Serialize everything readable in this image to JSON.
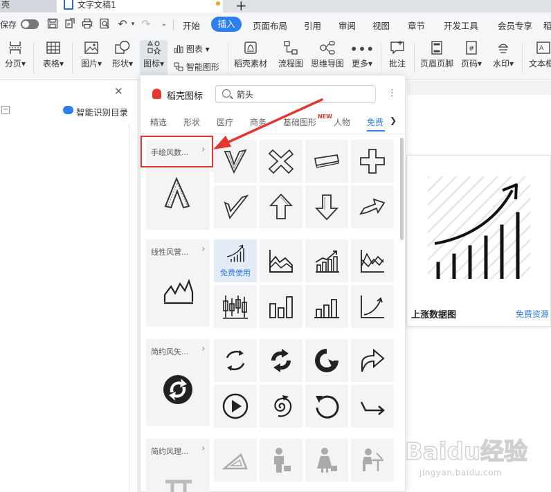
{
  "tabs": {
    "prev": "壳",
    "doc": "文字文稿1"
  },
  "menu": {
    "autosave": "保存",
    "items": [
      "开始",
      "插入",
      "页面布局",
      "引用",
      "审阅",
      "视图",
      "章节",
      "开发工具",
      "会员专享",
      "稻"
    ]
  },
  "toolbar": {
    "page_break": "分页",
    "table": "表格",
    "picture": "图片",
    "shape": "形状",
    "icon": "图标",
    "chart": "图表",
    "smart_art": "智能图形",
    "docer_material": "稻壳素材",
    "flowchart": "流程图",
    "mindmap": "思维导图",
    "more": "更多",
    "comment": "批注",
    "header_footer": "页眉页脚",
    "page_number": "页码",
    "watermark": "水印",
    "textbox": "文本框"
  },
  "left_pane": {
    "smart_toc": "智能识别目录"
  },
  "popup": {
    "title": "稻壳图标",
    "search_value": "箭头",
    "categories": [
      "精选",
      "形状",
      "医疗",
      "商务",
      "基础图形",
      "人物",
      "免费"
    ],
    "new_badge": "NEW",
    "groups": [
      {
        "label": "手绘风数..."
      },
      {
        "label": "线性风营..."
      },
      {
        "label": "简约风矢..."
      },
      {
        "label": "简约风理..."
      }
    ],
    "free_use": "免费使用"
  },
  "preview": {
    "title": "上涨数据图",
    "link": "免费资源"
  },
  "watermark": {
    "brand": "Baidu经验",
    "url": "jingyan.baidu.com"
  },
  "colors": {
    "accent": "#2d7ef0",
    "annotation": "#e53730",
    "docer_red": "#e8372c"
  }
}
